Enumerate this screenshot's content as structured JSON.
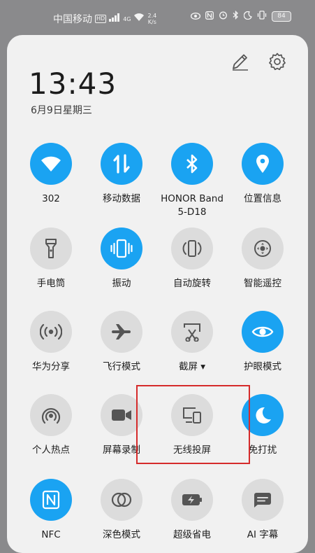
{
  "status_bar": {
    "carrier": "中国移动",
    "hd_badge": "HD",
    "network": "4G",
    "speed_value": "2.4",
    "speed_unit": "K/s",
    "battery": "84"
  },
  "header": {
    "time": "13:43",
    "date": "6月9日星期三",
    "edit_icon": "pencil-icon",
    "settings_icon": "gear-icon"
  },
  "tiles": [
    {
      "label": "302",
      "icon": "wifi-icon",
      "active": true
    },
    {
      "label": "移动数据",
      "icon": "mobile-data-icon",
      "active": true
    },
    {
      "label": "HONOR Band\n5-D18",
      "icon": "bluetooth-icon",
      "active": true
    },
    {
      "label": "位置信息",
      "icon": "location-icon",
      "active": true
    },
    {
      "label": "手电筒",
      "icon": "flashlight-icon",
      "active": false
    },
    {
      "label": "振动",
      "icon": "vibrate-icon",
      "active": true
    },
    {
      "label": "自动旋转",
      "icon": "auto-rotate-icon",
      "active": false
    },
    {
      "label": "智能遥控",
      "icon": "remote-control-icon",
      "active": false
    },
    {
      "label": "华为分享",
      "icon": "huawei-share-icon",
      "active": false
    },
    {
      "label": "飞行模式",
      "icon": "airplane-icon",
      "active": false
    },
    {
      "label": "截屏 ▾",
      "icon": "screenshot-icon",
      "active": false
    },
    {
      "label": "护眼模式",
      "icon": "eye-comfort-icon",
      "active": true
    },
    {
      "label": "个人热点",
      "icon": "hotspot-icon",
      "active": false
    },
    {
      "label": "屏幕录制",
      "icon": "screen-record-icon",
      "active": false
    },
    {
      "label": "无线投屏",
      "icon": "wireless-projection-icon",
      "active": false
    },
    {
      "label": "免打扰",
      "icon": "do-not-disturb-icon",
      "active": true
    },
    {
      "label": "NFC",
      "icon": "nfc-icon",
      "active": true
    },
    {
      "label": "深色模式",
      "icon": "dark-mode-icon",
      "active": false
    },
    {
      "label": "超级省电",
      "icon": "power-saving-icon",
      "active": false
    },
    {
      "label": "AI 字幕",
      "icon": "ai-subtitle-icon",
      "active": false
    }
  ],
  "colors": {
    "active": "#1aa3f2",
    "inactive": "#dcdcdc",
    "highlight_box": "#d52b2b"
  }
}
